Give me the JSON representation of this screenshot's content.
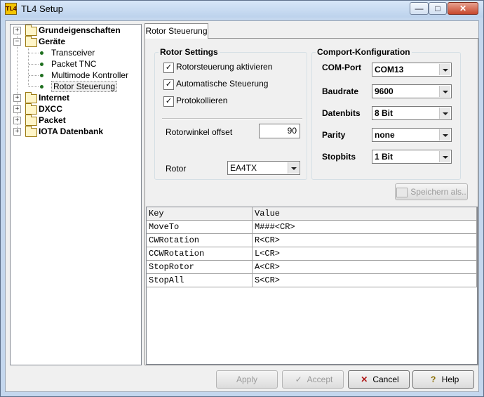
{
  "window": {
    "title": "TL4 Setup",
    "app_icon_text": "TL4",
    "min_label": "—",
    "max_label": "□",
    "close_label": "✕"
  },
  "tree": {
    "items": [
      {
        "label": "Grundeigenschaften",
        "bold": true,
        "type": "folder",
        "expander": "+"
      },
      {
        "label": "Geräte",
        "bold": true,
        "type": "folder-open",
        "expander": "−"
      },
      {
        "label": "Transceiver",
        "bold": false,
        "type": "leaf"
      },
      {
        "label": "Packet TNC",
        "bold": false,
        "type": "leaf"
      },
      {
        "label": "Multimode Kontroller",
        "bold": false,
        "type": "leaf"
      },
      {
        "label": "Rotor Steuerung",
        "bold": false,
        "type": "leaf"
      },
      {
        "label": "Internet",
        "bold": true,
        "type": "folder",
        "expander": "+"
      },
      {
        "label": "DXCC",
        "bold": true,
        "type": "folder",
        "expander": "+"
      },
      {
        "label": "Packet",
        "bold": true,
        "type": "folder",
        "expander": "+"
      },
      {
        "label": "IOTA Datenbank",
        "bold": true,
        "type": "folder",
        "expander": "+"
      }
    ]
  },
  "tab": {
    "label": "Rotor Steuerung"
  },
  "rotor_settings": {
    "legend": "Rotor Settings",
    "checkboxes": [
      {
        "label": "Rotorsteuerung aktivieren",
        "checked": "✓"
      },
      {
        "label": "Automatische Steuerung",
        "checked": "✓"
      },
      {
        "label": "Protokollieren",
        "checked": "✓"
      }
    ],
    "offset_label": "Rotorwinkel offset",
    "offset_value": "90",
    "rotor_label": "Rotor",
    "rotor_value": "EA4TX"
  },
  "comport": {
    "legend": "Comport-Konfiguration",
    "fields": [
      {
        "label": "COM-Port",
        "value": "COM13"
      },
      {
        "label": "Baudrate",
        "value": "9600"
      },
      {
        "label": "Datenbits",
        "value": "8 Bit"
      },
      {
        "label": "Parity",
        "value": "none"
      },
      {
        "label": "Stopbits",
        "value": "1 Bit"
      }
    ]
  },
  "save_as_button": "Speichern als..",
  "grid": {
    "headers": [
      "Key",
      "Value"
    ],
    "rows": [
      [
        "MoveTo",
        "M###<CR>"
      ],
      [
        "CWRotation",
        "R<CR>"
      ],
      [
        "CCWRotation",
        "L<CR>"
      ],
      [
        "StopRotor",
        "A<CR>"
      ],
      [
        "StopAll",
        "S<CR>"
      ]
    ]
  },
  "buttons": {
    "apply": "Apply",
    "accept": "Accept",
    "cancel": "Cancel",
    "help": "Help",
    "accept_icon": "✓",
    "cancel_icon": "✕",
    "help_icon": "?"
  }
}
